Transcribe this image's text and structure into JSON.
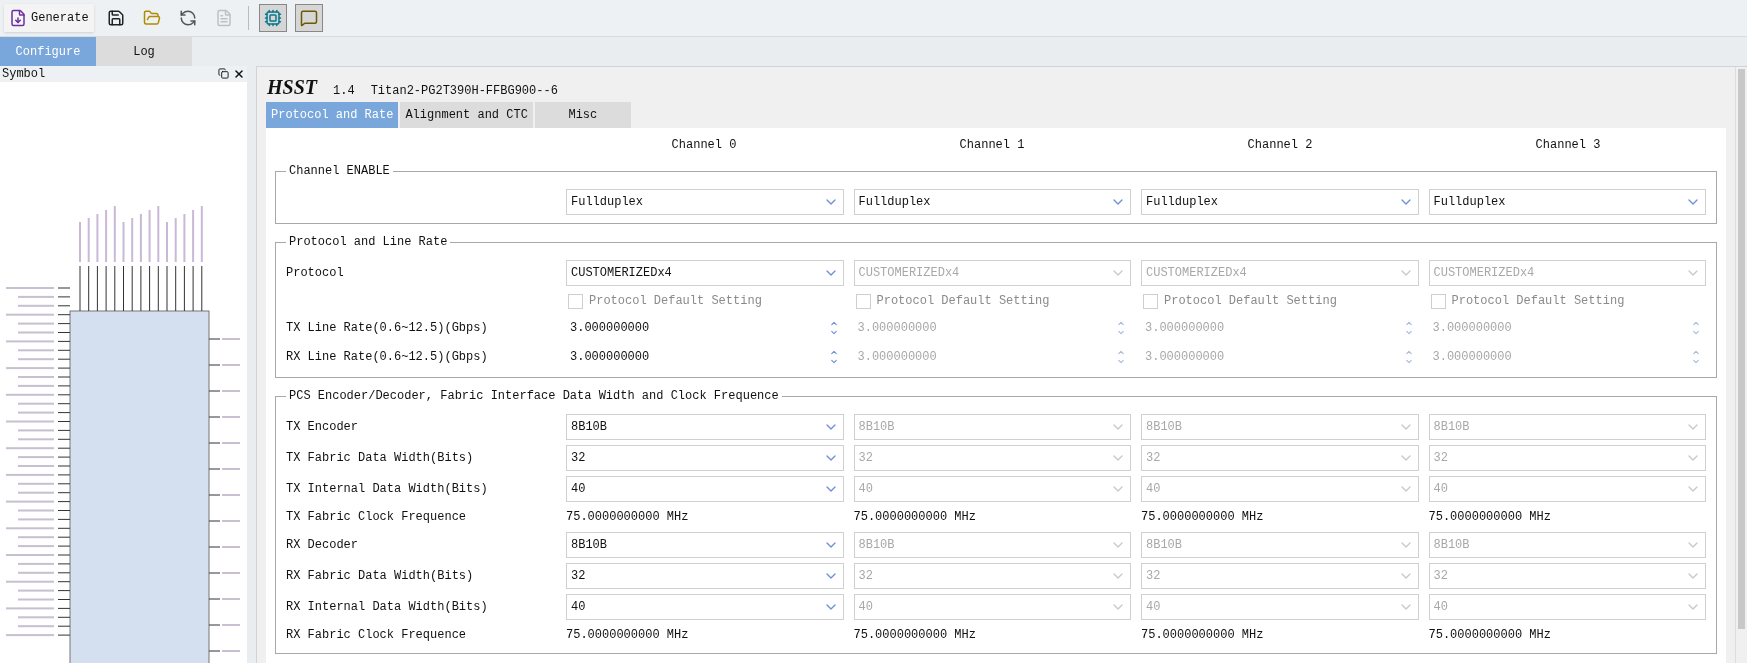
{
  "toolbar": [
    {
      "kind": "generate",
      "label": "Generate",
      "pressed": false,
      "disabled": false
    },
    {
      "kind": "save",
      "pressed": false,
      "disabled": false
    },
    {
      "kind": "open",
      "pressed": false,
      "disabled": false
    },
    {
      "kind": "reload",
      "pressed": false,
      "disabled": false
    },
    {
      "kind": "document",
      "pressed": false,
      "disabled": true
    },
    {
      "kind": "chip",
      "pressed": true,
      "disabled": false
    },
    {
      "kind": "comment",
      "pressed": true,
      "disabled": false
    }
  ],
  "main_tabs": [
    {
      "label": "Configure",
      "selected": true
    },
    {
      "label": "Log",
      "selected": false
    }
  ],
  "symbol_panel": {
    "title": "Symbol"
  },
  "header": {
    "title": "HSST",
    "version": "1.4",
    "device": "Titan2-PG2T390H-FFBG900--6"
  },
  "tabs": [
    {
      "label": "Protocol and Rate",
      "selected": true
    },
    {
      "label": "Alignment and CTC",
      "selected": false
    },
    {
      "label": "Misc",
      "selected": false
    }
  ],
  "channels": [
    "Channel 0",
    "Channel 1",
    "Channel 2",
    "Channel 3"
  ],
  "sections": [
    {
      "title": "Channel ENABLE",
      "rows": [
        {
          "kind": "select",
          "cells": [
            {
              "value": "Fullduplex",
              "disabled": false
            },
            {
              "value": "Fullduplex",
              "disabled": false
            },
            {
              "value": "Fullduplex",
              "disabled": false
            },
            {
              "value": "Fullduplex",
              "disabled": false
            }
          ]
        }
      ]
    },
    {
      "title": "Protocol and Line Rate",
      "rows": [
        {
          "kind": "select",
          "label": "Protocol",
          "cells": [
            {
              "value": "CUSTOMERIZEDx4",
              "disabled": false
            },
            {
              "value": "CUSTOMERIZEDx4",
              "disabled": true
            },
            {
              "value": "CUSTOMERIZEDx4",
              "disabled": true
            },
            {
              "value": "CUSTOMERIZEDx4",
              "disabled": true
            }
          ]
        },
        {
          "kind": "checkbox",
          "cells": [
            {
              "value": "Protocol Default Setting",
              "disabled": true,
              "checked": false
            },
            {
              "value": "Protocol Default Setting",
              "disabled": true,
              "checked": false
            },
            {
              "value": "Protocol Default Setting",
              "disabled": true,
              "checked": false
            },
            {
              "value": "Protocol Default Setting",
              "disabled": true,
              "checked": false
            }
          ]
        },
        {
          "kind": "spin",
          "label": "TX Line Rate(0.6~12.5)(Gbps)",
          "cells": [
            {
              "value": "3.000000000",
              "disabled": false
            },
            {
              "value": "3.000000000",
              "disabled": true
            },
            {
              "value": "3.000000000",
              "disabled": true
            },
            {
              "value": "3.000000000",
              "disabled": true
            }
          ]
        },
        {
          "kind": "spin",
          "label": "RX Line Rate(0.6~12.5)(Gbps)",
          "cells": [
            {
              "value": "3.000000000",
              "disabled": false
            },
            {
              "value": "3.000000000",
              "disabled": true
            },
            {
              "value": "3.000000000",
              "disabled": true
            },
            {
              "value": "3.000000000",
              "disabled": true
            }
          ]
        }
      ]
    },
    {
      "title": "PCS Encoder/Decoder, Fabric Interface Data Width and Clock Frequence",
      "rows": [
        {
          "kind": "select",
          "label": "TX Encoder",
          "cells": [
            {
              "value": "8B10B",
              "disabled": false
            },
            {
              "value": "8B10B",
              "disabled": true
            },
            {
              "value": "8B10B",
              "disabled": true
            },
            {
              "value": "8B10B",
              "disabled": true
            }
          ]
        },
        {
          "kind": "select",
          "label": "TX Fabric Data Width(Bits)",
          "cells": [
            {
              "value": "32",
              "disabled": false
            },
            {
              "value": "32",
              "disabled": true
            },
            {
              "value": "32",
              "disabled": true
            },
            {
              "value": "32",
              "disabled": true
            }
          ]
        },
        {
          "kind": "select",
          "label": "TX Internal Data Width(Bits)",
          "cells": [
            {
              "value": "40",
              "disabled": false
            },
            {
              "value": "40",
              "disabled": true
            },
            {
              "value": "40",
              "disabled": true
            },
            {
              "value": "40",
              "disabled": true
            }
          ]
        },
        {
          "kind": "text",
          "label": "TX Fabric Clock Frequence",
          "cells": [
            {
              "value": "75.0000000000 MHz",
              "disabled": false
            },
            {
              "value": "75.0000000000 MHz",
              "disabled": false
            },
            {
              "value": "75.0000000000 MHz",
              "disabled": false
            },
            {
              "value": "75.0000000000 MHz",
              "disabled": false
            }
          ]
        },
        {
          "kind": "select",
          "label": "RX Decoder",
          "cells": [
            {
              "value": "8B10B",
              "disabled": false
            },
            {
              "value": "8B10B",
              "disabled": true
            },
            {
              "value": "8B10B",
              "disabled": true
            },
            {
              "value": "8B10B",
              "disabled": true
            }
          ]
        },
        {
          "kind": "select",
          "label": "RX Fabric Data Width(Bits)",
          "cells": [
            {
              "value": "32",
              "disabled": false
            },
            {
              "value": "32",
              "disabled": true
            },
            {
              "value": "32",
              "disabled": true
            },
            {
              "value": "32",
              "disabled": true
            }
          ]
        },
        {
          "kind": "select",
          "label": "RX Internal Data Width(Bits)",
          "cells": [
            {
              "value": "40",
              "disabled": false
            },
            {
              "value": "40",
              "disabled": true
            },
            {
              "value": "40",
              "disabled": true
            },
            {
              "value": "40",
              "disabled": true
            }
          ]
        },
        {
          "kind": "text",
          "label": "RX Fabric Clock Frequence",
          "cells": [
            {
              "value": "75.0000000000 MHz",
              "disabled": false
            },
            {
              "value": "75.0000000000 MHz",
              "disabled": false
            },
            {
              "value": "75.0000000000 MHz",
              "disabled": false
            },
            {
              "value": "75.0000000000 MHz",
              "disabled": false
            }
          ]
        }
      ]
    }
  ]
}
